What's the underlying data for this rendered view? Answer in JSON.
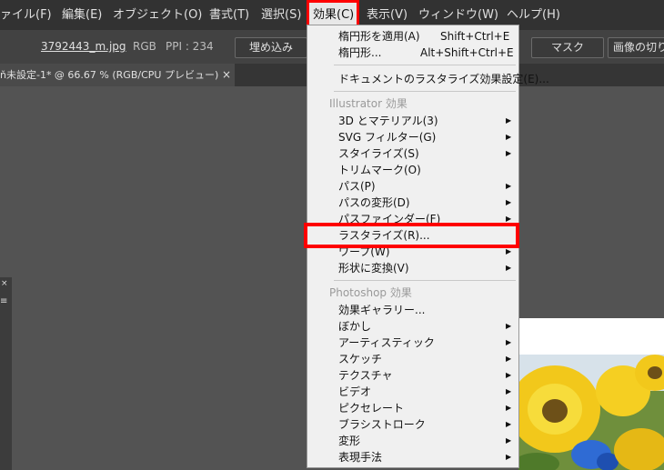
{
  "menubar": {
    "items": [
      "ァイル(F)",
      "編集(E)",
      "オブジェクト(O)",
      "書式(T)",
      "選択(S)",
      "効果(C)",
      "表示(V)",
      "ウィンドウ(W)",
      "ヘルプ(H)"
    ]
  },
  "control_bar": {
    "filename": "3792443_m.jpg",
    "color_mode": "RGB",
    "ppi": "PPI : 234",
    "embed_label": "埋め込み",
    "mask_label": "マスク",
    "crop_label": "画像の切り"
  },
  "document_tab": {
    "title": "ň未設定-1* @ 66.67 % (RGB/CPU プレビュー)",
    "close_glyph": "×"
  },
  "left_panel": {
    "close_glyph": "×",
    "menu_glyph": "≡"
  },
  "dropdown": {
    "items": [
      {
        "label": "楕円形を適用(A)",
        "shortcut": "Shift+Ctrl+E",
        "arrow": false,
        "disabled": false
      },
      {
        "label": "楕円形...",
        "shortcut": "Alt+Shift+Ctrl+E",
        "arrow": false,
        "disabled": false
      },
      {
        "label": "ドキュメントのラスタライズ効果設定(E)...",
        "shortcut": "",
        "arrow": false,
        "disabled": false
      },
      {
        "label": "Illustrator 効果",
        "shortcut": "",
        "arrow": false,
        "disabled": true
      },
      {
        "label": "3D とマテリアル(3)",
        "shortcut": "",
        "arrow": true,
        "disabled": false
      },
      {
        "label": "SVG フィルター(G)",
        "shortcut": "",
        "arrow": true,
        "disabled": false
      },
      {
        "label": "スタイライズ(S)",
        "shortcut": "",
        "arrow": true,
        "disabled": false
      },
      {
        "label": "トリムマーク(O)",
        "shortcut": "",
        "arrow": false,
        "disabled": false
      },
      {
        "label": "パス(P)",
        "shortcut": "",
        "arrow": true,
        "disabled": false
      },
      {
        "label": "パスの変形(D)",
        "shortcut": "",
        "arrow": true,
        "disabled": false
      },
      {
        "label": "パスファインダー(F)",
        "shortcut": "",
        "arrow": true,
        "disabled": false
      },
      {
        "label": "ラスタライズ(R)...",
        "shortcut": "",
        "arrow": false,
        "disabled": false
      },
      {
        "label": "ワープ(W)",
        "shortcut": "",
        "arrow": true,
        "disabled": false
      },
      {
        "label": "形状に変換(V)",
        "shortcut": "",
        "arrow": true,
        "disabled": false
      },
      {
        "label": "Photoshop 効果",
        "shortcut": "",
        "arrow": false,
        "disabled": true
      },
      {
        "label": "効果ギャラリー...",
        "shortcut": "",
        "arrow": false,
        "disabled": false
      },
      {
        "label": "ぼかし",
        "shortcut": "",
        "arrow": true,
        "disabled": false
      },
      {
        "label": "アーティスティック",
        "shortcut": "",
        "arrow": true,
        "disabled": false
      },
      {
        "label": "スケッチ",
        "shortcut": "",
        "arrow": true,
        "disabled": false
      },
      {
        "label": "テクスチャ",
        "shortcut": "",
        "arrow": true,
        "disabled": false
      },
      {
        "label": "ビデオ",
        "shortcut": "",
        "arrow": true,
        "disabled": false
      },
      {
        "label": "ピクセレート",
        "shortcut": "",
        "arrow": true,
        "disabled": false
      },
      {
        "label": "ブラシストローク",
        "shortcut": "",
        "arrow": true,
        "disabled": false
      },
      {
        "label": "変形",
        "shortcut": "",
        "arrow": true,
        "disabled": false
      },
      {
        "label": "表現手法",
        "shortcut": "",
        "arrow": true,
        "disabled": false
      }
    ],
    "arrow_glyph": "▶"
  },
  "colors": {
    "highlight_box": "#ff0000",
    "menubar_bg": "#323232",
    "workspace_bg": "#535353",
    "menu_bg": "#f0f0f0"
  }
}
